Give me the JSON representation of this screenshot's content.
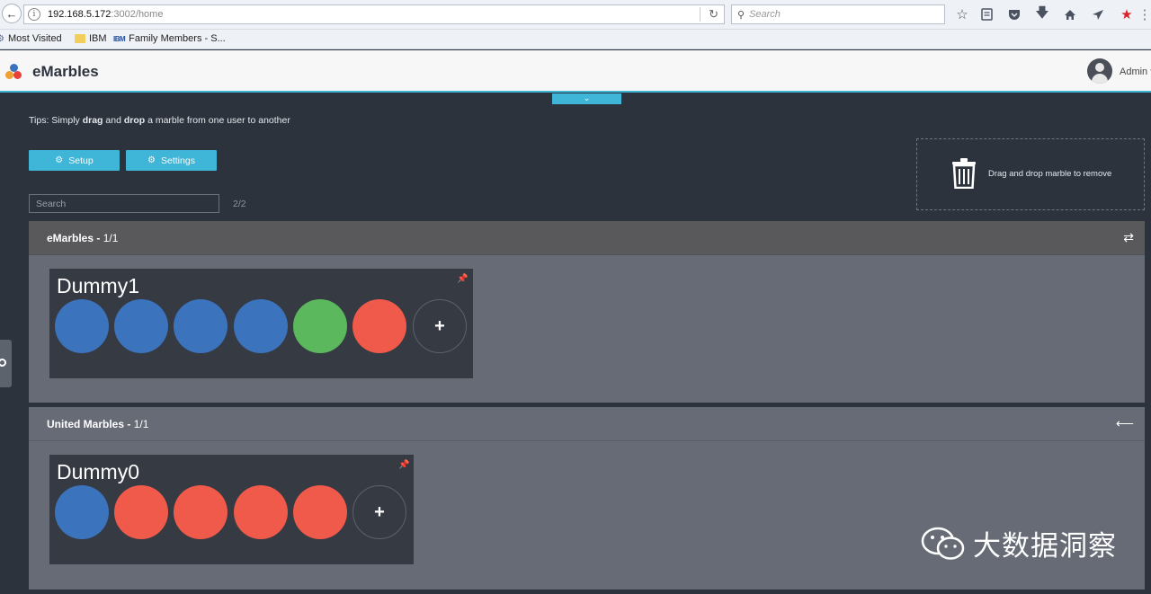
{
  "browser": {
    "url_host": "192.168.5.172",
    "url_path": ":3002/home",
    "search_placeholder": "Search",
    "bookmarks": [
      "Most Visited",
      "IBM",
      "Family Members - S..."
    ]
  },
  "app": {
    "title": "eMarbles",
    "user": "Admin"
  },
  "tips": {
    "prefix": "Tips: Simply ",
    "drag": "drag",
    "and": " and ",
    "drop": "drop",
    "suffix": " a marble from one user to another"
  },
  "toolbar": {
    "setup_label": "Setup",
    "settings_label": "Settings"
  },
  "search": {
    "placeholder": "Search",
    "count": "2/2"
  },
  "trash": {
    "label": "Drag and drop marble to remove"
  },
  "companies": [
    {
      "name": "eMarbles",
      "count": "1/1",
      "users": [
        {
          "name": "Dummy1",
          "marbles": [
            "blue",
            "blue",
            "blue",
            "blue",
            "green",
            "red"
          ]
        }
      ]
    },
    {
      "name": "United Marbles",
      "count": "1/1",
      "users": [
        {
          "name": "Dummy0",
          "marbles": [
            "blue",
            "red",
            "red",
            "red",
            "red"
          ]
        }
      ]
    }
  ],
  "colors": {
    "accent": "#3fb6d8",
    "marble_blue": "#3b73bd",
    "marble_green": "#5cb85c",
    "marble_red": "#f05a4b",
    "background": "#2c333d",
    "panel": "#666b75",
    "panel_header": "#59585a",
    "card": "#353a43"
  },
  "watermark": {
    "text": "大数据洞察"
  }
}
